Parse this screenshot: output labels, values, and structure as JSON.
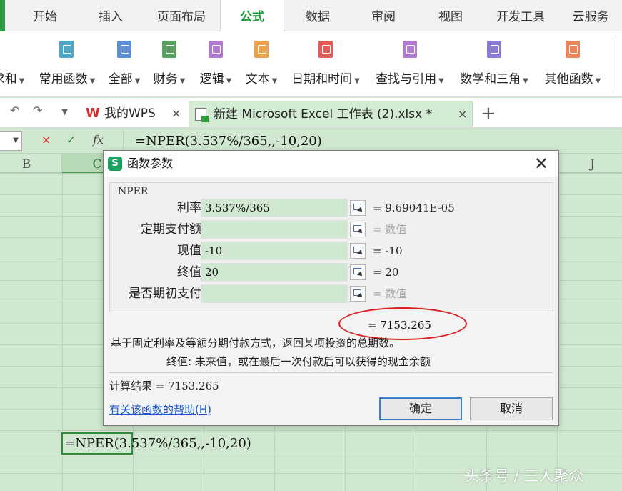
{
  "menubar": {
    "tabs": [
      "开始",
      "插入",
      "页面布局",
      "公式",
      "数据",
      "审阅",
      "视图",
      "开发工具",
      "云服务"
    ],
    "active_tab": "公式"
  },
  "ribbon": {
    "groups": [
      {
        "label": "求和",
        "icon": "sum-icon",
        "color": "#ffffff"
      },
      {
        "label": "常用函数",
        "icon": "common-functions-icon",
        "color": "#4aa8c6"
      },
      {
        "label": "全部",
        "icon": "all-functions-icon",
        "color": "#5e8fd6"
      },
      {
        "label": "财务",
        "icon": "finance-icon",
        "color": "#58a05e"
      },
      {
        "label": "逻辑",
        "icon": "logic-icon",
        "color": "#b07ad0"
      },
      {
        "label": "文本",
        "icon": "text-icon",
        "color": "#e8a24a"
      },
      {
        "label": "日期和时间",
        "icon": "datetime-icon",
        "color": "#e05c58"
      },
      {
        "label": "查找与引用",
        "icon": "lookup-icon",
        "color": "#b07ad0"
      },
      {
        "label": "数学和三角",
        "icon": "math-icon",
        "color": "#8a7bd6"
      },
      {
        "label": "其他函数",
        "icon": "other-functions-icon",
        "color": "#e8855a"
      }
    ]
  },
  "tabbar": {
    "home_tab": "我的WPS",
    "doc_tab": "新建 Microsoft Excel 工作表 (2).xlsx *",
    "close_glyph": "×",
    "new_tab_glyph": "+"
  },
  "formulabar": {
    "cancel_glyph": "×",
    "confirm_glyph": "✓",
    "fx_label": "fx",
    "formula": "=NPER(3.537%/365,,-10,20)"
  },
  "sheet": {
    "columns": [
      "B",
      "C",
      "J"
    ],
    "selected_column": "C",
    "cell_formula": "=NPER(3.537%/365,,-10,20)"
  },
  "dialog": {
    "title": "函数参数",
    "logo_letter": "S",
    "function_name": "NPER",
    "params": [
      {
        "label": "利率",
        "value": "3.537%/365",
        "result": "= 9.69041E-05",
        "placeholder": false
      },
      {
        "label": "定期支付额",
        "value": "",
        "result": "= 数值",
        "placeholder": true
      },
      {
        "label": "现值",
        "value": "-10",
        "result": "= -10",
        "placeholder": false
      },
      {
        "label": "终值",
        "value": "20",
        "result": "= 20",
        "placeholder": false
      },
      {
        "label": "是否期初支付",
        "value": "",
        "result": "= 数值",
        "placeholder": true
      }
    ],
    "total_result": "= 7153.265",
    "description": "基于固定利率及等额分期付款方式，返回某项投资的总期数。",
    "param_description": "终值: 未来值，或在最后一次付款后可以获得的现金余额",
    "calc_result": "计算结果 = 7153.265",
    "help_link": "有关该函数的帮助(H)",
    "ok_label": "确定",
    "cancel_label": "取消",
    "close_glyph": "✕"
  },
  "watermark": "头条号 / 三人聚众",
  "colors": {
    "accent_green": "#1f9a37",
    "sheet_bg": "#cfe8cf",
    "annotation_red": "#d81e1e"
  }
}
